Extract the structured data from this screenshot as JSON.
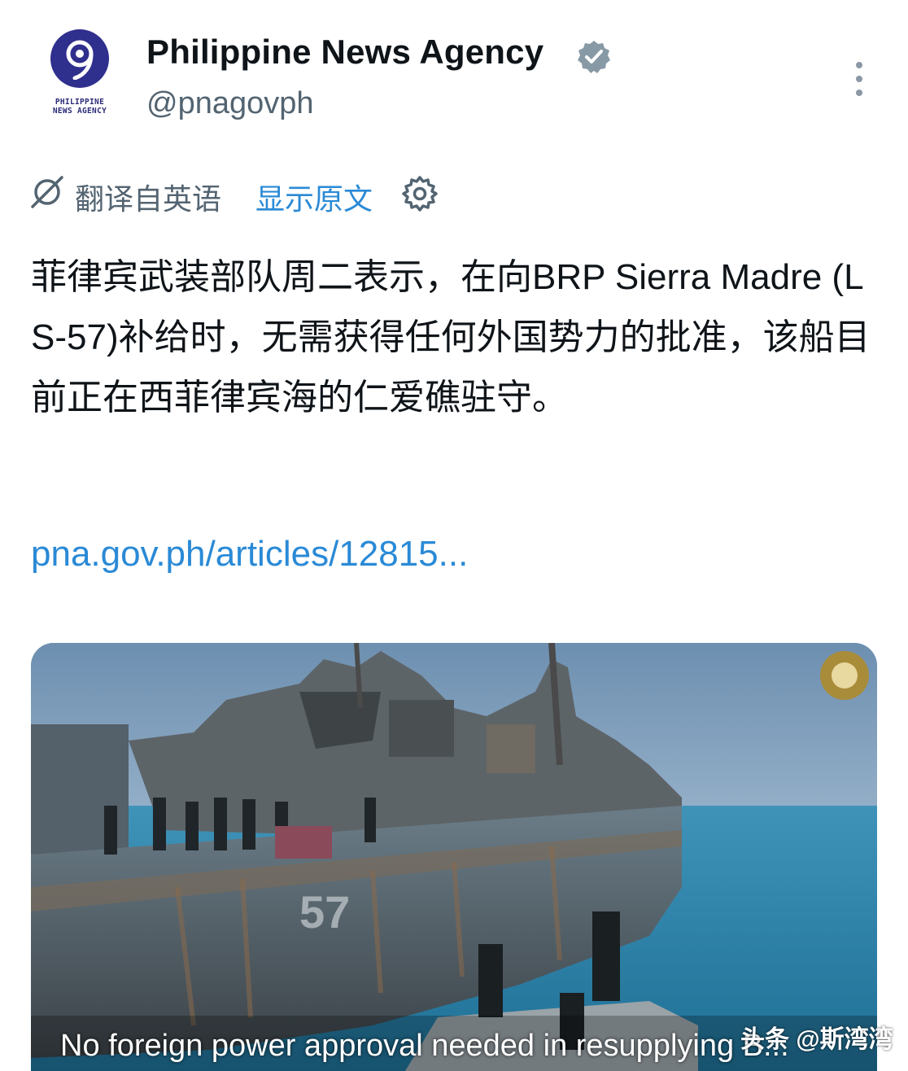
{
  "account": {
    "name": "Philippine News Agency",
    "handle": "@pnagovph",
    "logo_text": [
      "PHILIPPINE",
      "NEWS AGENCY"
    ],
    "verified": true,
    "verified_color": "#8899a6"
  },
  "translation": {
    "translated_from": "翻译自英语",
    "show_original": "显示原文",
    "icons": [
      "translate-icon",
      "gear-icon"
    ]
  },
  "tweet": {
    "text": "菲律宾武装部队周二表示，在向BRP Sierra Madre (LS-57)补给时，无需获得任何外国势力的批准，该船目前正在西菲律宾海的仁爱礁驻守。",
    "link": "pna.gov.ph/articles/12815..."
  },
  "media": {
    "hull_number": "57",
    "caption": "No foreign power approval needed in resupplying B..."
  },
  "watermark": "头条 @斯湾湾",
  "colors": {
    "accent_link": "#2a8ad6",
    "secondary_text": "#536471",
    "primary_text": "#0f1419",
    "logo_blue": "#2f2f8e"
  }
}
